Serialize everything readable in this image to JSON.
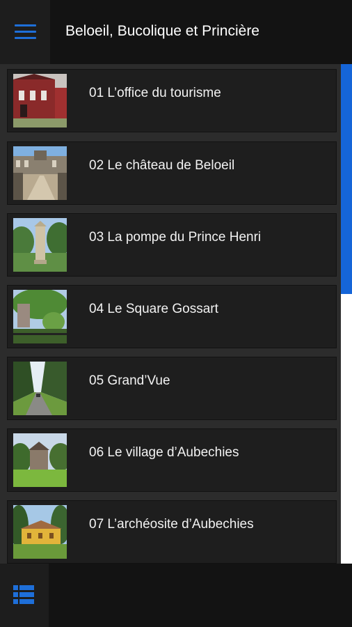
{
  "header": {
    "menu_icon": "hamburger-menu-icon",
    "title": "Beloeil, Bucolique et Princière",
    "accent_color": "#1e6fd9"
  },
  "list": {
    "items": [
      {
        "label": "01 L’office du tourisme",
        "thumbnail": "red-brick-building-photo"
      },
      {
        "label": "02 Le château de Beloeil",
        "thumbnail": "castle-courtyard-photo"
      },
      {
        "label": "03 La pompe du Prince Henri",
        "thumbnail": "stone-pump-monument-photo"
      },
      {
        "label": "04 Le Square Gossart",
        "thumbnail": "garden-square-photo"
      },
      {
        "label": "05 Grand’Vue",
        "thumbnail": "tree-lined-road-photo"
      },
      {
        "label": "06 Le village d’Aubechies",
        "thumbnail": "village-meadow-photo"
      },
      {
        "label": "07 L’archéosite d’Aubechies",
        "thumbnail": "yellow-roman-house-photo"
      }
    ]
  },
  "scrollbar": {
    "position_fraction": 0.0,
    "visible_fraction": 0.46,
    "thumb_color": "#1565d8"
  },
  "footer": {
    "view_icon": "list-view-icon"
  }
}
